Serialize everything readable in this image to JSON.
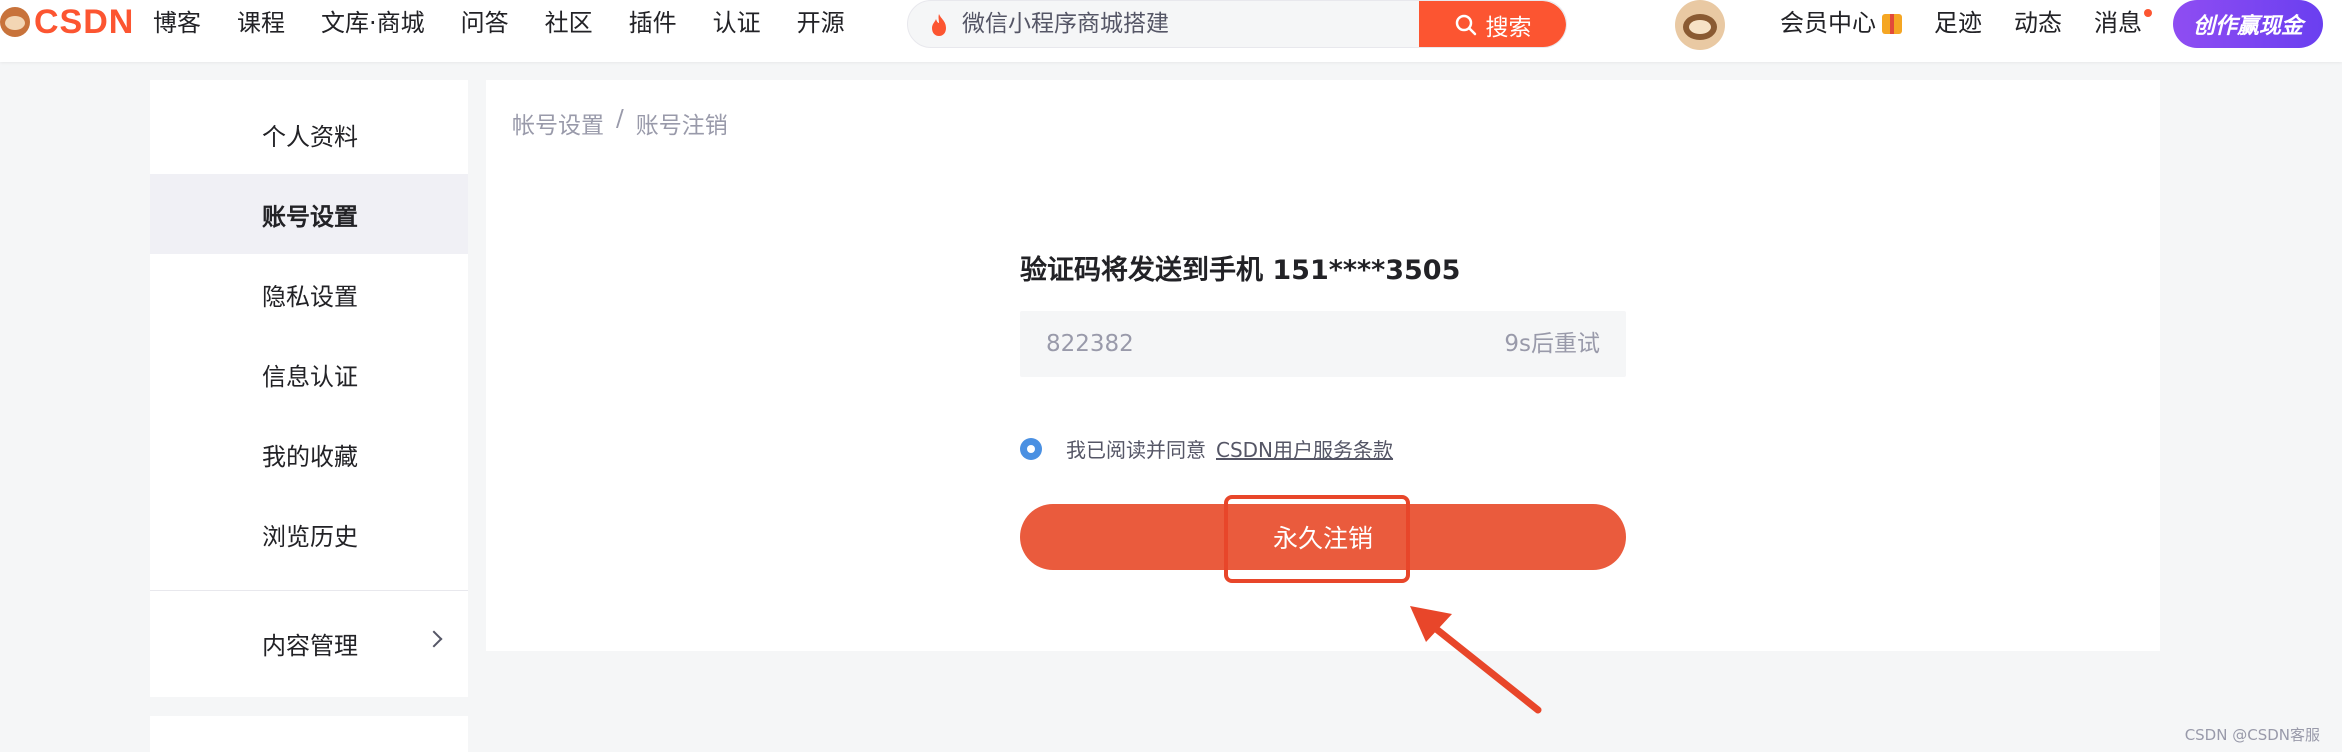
{
  "topbar": {
    "logo_text": "CSDN",
    "nav": [
      "博客",
      "课程",
      "文库·商城",
      "问答",
      "社区",
      "插件",
      "认证",
      "开源"
    ],
    "search": {
      "value": "微信小程序商城搭建",
      "button_label": "搜索"
    },
    "right_nav": {
      "vip": "会员中心",
      "footprint": "足迹",
      "activity": "动态",
      "messages": "消息"
    },
    "create_button": "创作赢现金"
  },
  "sidebar": {
    "items": [
      "个人资料",
      "账号设置",
      "隐私设置",
      "信息认证",
      "我的收藏",
      "浏览历史"
    ],
    "active_index": 1,
    "content_management": "内容管理"
  },
  "main": {
    "breadcrumb": [
      "帐号设置",
      "账号注销"
    ],
    "breadcrumb_sep": "/",
    "verify_title": "验证码将发送到手机  151****3505",
    "code_value": "822382",
    "resend_text": "9s后重试",
    "agree_text": "我已阅读并同意",
    "terms_link": "CSDN用户服务条款",
    "delete_button": "永久注销"
  },
  "watermark": "CSDN @CSDN客服",
  "colors": {
    "accent": "#fc5531",
    "delete_button": "#ea5b3d",
    "annotation": "#e8462a",
    "radio": "#4a90e2"
  }
}
